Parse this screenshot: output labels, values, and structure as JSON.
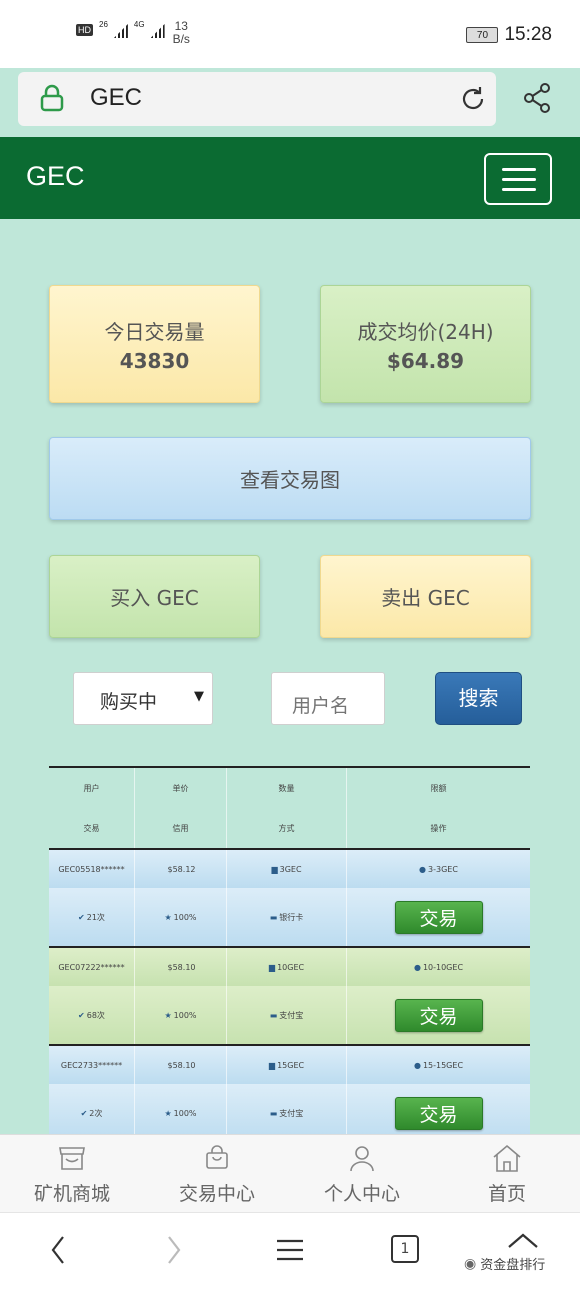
{
  "status_bar": {
    "hd": "HD",
    "net1": "26",
    "net2": "4G",
    "speed_value": "13",
    "speed_unit": "B/s",
    "battery": "70",
    "time": "15:28"
  },
  "address_bar": {
    "url": "GEC"
  },
  "header": {
    "title": "GEC"
  },
  "stats": [
    {
      "label": "今日交易量",
      "value": "43830"
    },
    {
      "label": "成交均价(24H)",
      "value": "$64.89"
    }
  ],
  "actions": {
    "chart": "查看交易图",
    "buy": "买入 GEC",
    "sell": "卖出 GEC"
  },
  "filter": {
    "select_value": "购买中",
    "user_placeholder": "用户名",
    "search_label": "搜索"
  },
  "table": {
    "headers_row1": [
      "用户",
      "单价",
      "数量",
      "限额"
    ],
    "headers_row2": [
      "交易",
      "信用",
      "方式",
      "操作"
    ],
    "rows": [
      {
        "user": "GEC05518******",
        "price": "$58.12",
        "qty": "3GEC",
        "limit": "3-3GEC",
        "trades": "21次",
        "credit": "100%",
        "method": "银行卡",
        "action": "交易"
      },
      {
        "user": "GEC07222******",
        "price": "$58.10",
        "qty": "10GEC",
        "limit": "10-10GEC",
        "trades": "68次",
        "credit": "100%",
        "method": "支付宝",
        "action": "交易"
      },
      {
        "user": "GEC2733******",
        "price": "$58.10",
        "qty": "15GEC",
        "limit": "15-15GEC",
        "trades": "2次",
        "credit": "100%",
        "method": "支付宝",
        "action": "交易"
      }
    ]
  },
  "bottom_nav": [
    {
      "label": "矿机商城",
      "icon": "shop-icon"
    },
    {
      "label": "交易中心",
      "icon": "bag-icon"
    },
    {
      "label": "个人中心",
      "icon": "user-icon"
    },
    {
      "label": "首页",
      "icon": "home-icon"
    }
  ],
  "browser": {
    "tabs_count": "1"
  },
  "watermark": "资金盘排行"
}
